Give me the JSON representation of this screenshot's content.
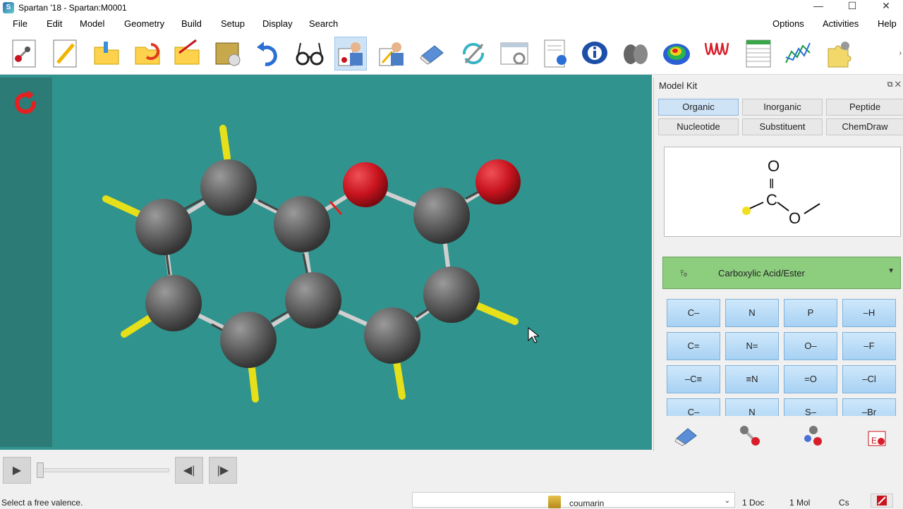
{
  "window": {
    "title": "Spartan '18 - Spartan:M0001",
    "minimize": "—",
    "maximize": "☐",
    "close": "✕"
  },
  "menu": {
    "file": "File",
    "edit": "Edit",
    "model": "Model",
    "geometry": "Geometry",
    "build": "Build",
    "setup": "Setup",
    "display": "Display",
    "search": "Search",
    "options": "Options",
    "activities": "Activities",
    "help": "Help"
  },
  "toolbar": {
    "icons": [
      "new-build-icon",
      "edit-icon",
      "open-icon",
      "open-recent-icon",
      "save-icon",
      "save-as-icon",
      "undo-icon",
      "view-icon",
      "add-fragment-icon",
      "edit-build-icon",
      "delete-icon",
      "minimize-icon",
      "properties-icon",
      "output-icon",
      "info-icon",
      "orbitals-icon",
      "map-icon",
      "spectra-icon",
      "spreadsheet-icon",
      "plots-icon",
      "modify-icon"
    ],
    "active": "add-fragment-icon",
    "more": "›"
  },
  "model_kit": {
    "title": "Model Kit",
    "tabs_row1": [
      "Organic",
      "Inorganic",
      "Peptide"
    ],
    "tabs_row2": [
      "Nucleotide",
      "Substituent",
      "ChemDraw"
    ],
    "active_tab": "Organic",
    "preview": {
      "atom_top": "O",
      "bond_top": "‖",
      "atom_center": "C",
      "atom_right": "O"
    },
    "group_icon": "O\n‖\nC—O",
    "group_label": "Carboxylic Acid/Ester",
    "group_arrow": "▼",
    "fragments": [
      [
        "C–",
        "N",
        "P",
        "–H"
      ],
      [
        "C=",
        "N=",
        "O–",
        "–F"
      ],
      [
        "–C≡",
        "≡N",
        "=O",
        "–Cl"
      ],
      [
        "C–",
        "N",
        "S–",
        "–Br"
      ]
    ],
    "bottom_tools": [
      "eraser-icon",
      "bond-icon",
      "atoms-icon",
      "element-icon"
    ]
  },
  "playback": {
    "play": "▶",
    "step_back": "◀|",
    "step_forward": "|▶"
  },
  "status": {
    "message": "Select a free valence.",
    "document": "coumarin",
    "doc_arrow": "⌄",
    "docs": "1 Doc",
    "mols": "1 Mol",
    "symmetry": "Cs"
  },
  "colors": {
    "viewport": "#31938e",
    "carbon": "#5b5b5b",
    "oxygen": "#c8141e",
    "hydrogen": "#e6e01a",
    "accent_tab": "#cfe3f7",
    "group_bar": "#8dcd7e"
  }
}
